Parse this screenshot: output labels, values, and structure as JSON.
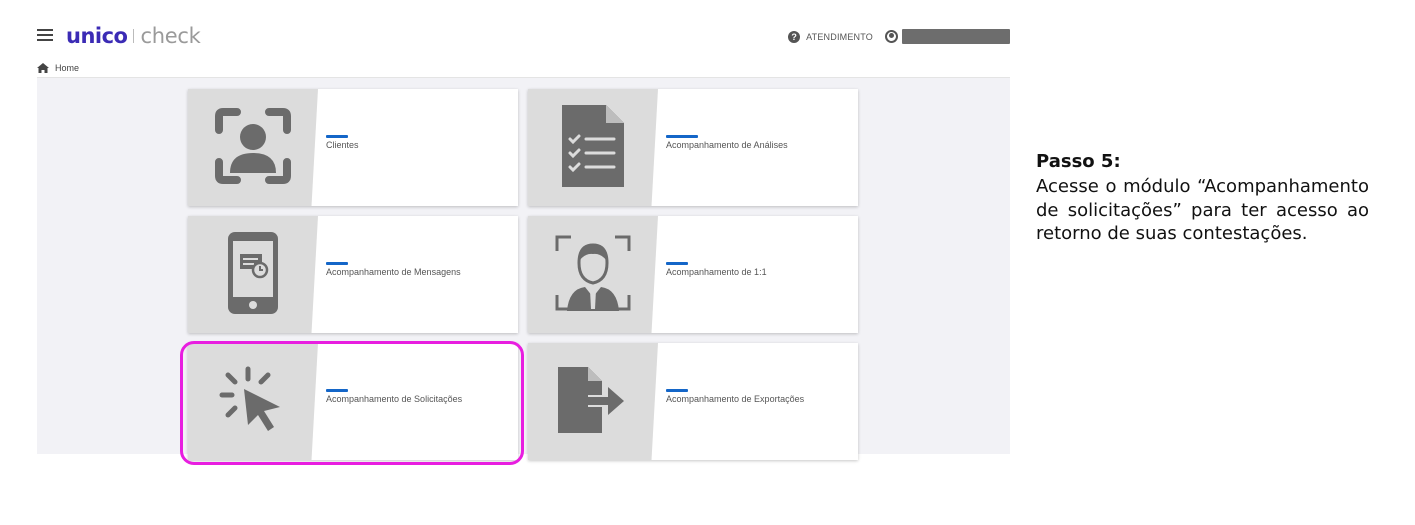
{
  "header": {
    "brand": "unico",
    "product": "check",
    "support_label": "ATENDIMENTO",
    "help_icon": "question-circle-icon",
    "user_icon": "user-circle-icon"
  },
  "breadcrumb": {
    "home_label": "Home",
    "icon": "home-icon"
  },
  "modules": [
    {
      "label": "Clientes",
      "icon": "face-scan-icon"
    },
    {
      "label": "Acompanhamento de Análises",
      "icon": "checklist-document-icon"
    },
    {
      "label": "Acompanhamento de Mensagens",
      "icon": "smartphone-message-icon"
    },
    {
      "label": "Acompanhamento de 1:1",
      "icon": "person-portrait-icon"
    },
    {
      "label": "Acompanhamento de Solicitações",
      "icon": "pointer-click-icon"
    },
    {
      "label": "Acompanhamento de Exportações",
      "icon": "file-export-icon"
    }
  ],
  "instruction": {
    "title": "Passo 5:",
    "text": "Acesse o módulo “Acompanhamento de solicitações” para ter acesso ao retorno de suas contestações."
  },
  "colors": {
    "brand": "#3b2bb5",
    "accent": "#1466c8",
    "highlight": "#e81ee0",
    "icon_gray": "#6b6b6b"
  }
}
